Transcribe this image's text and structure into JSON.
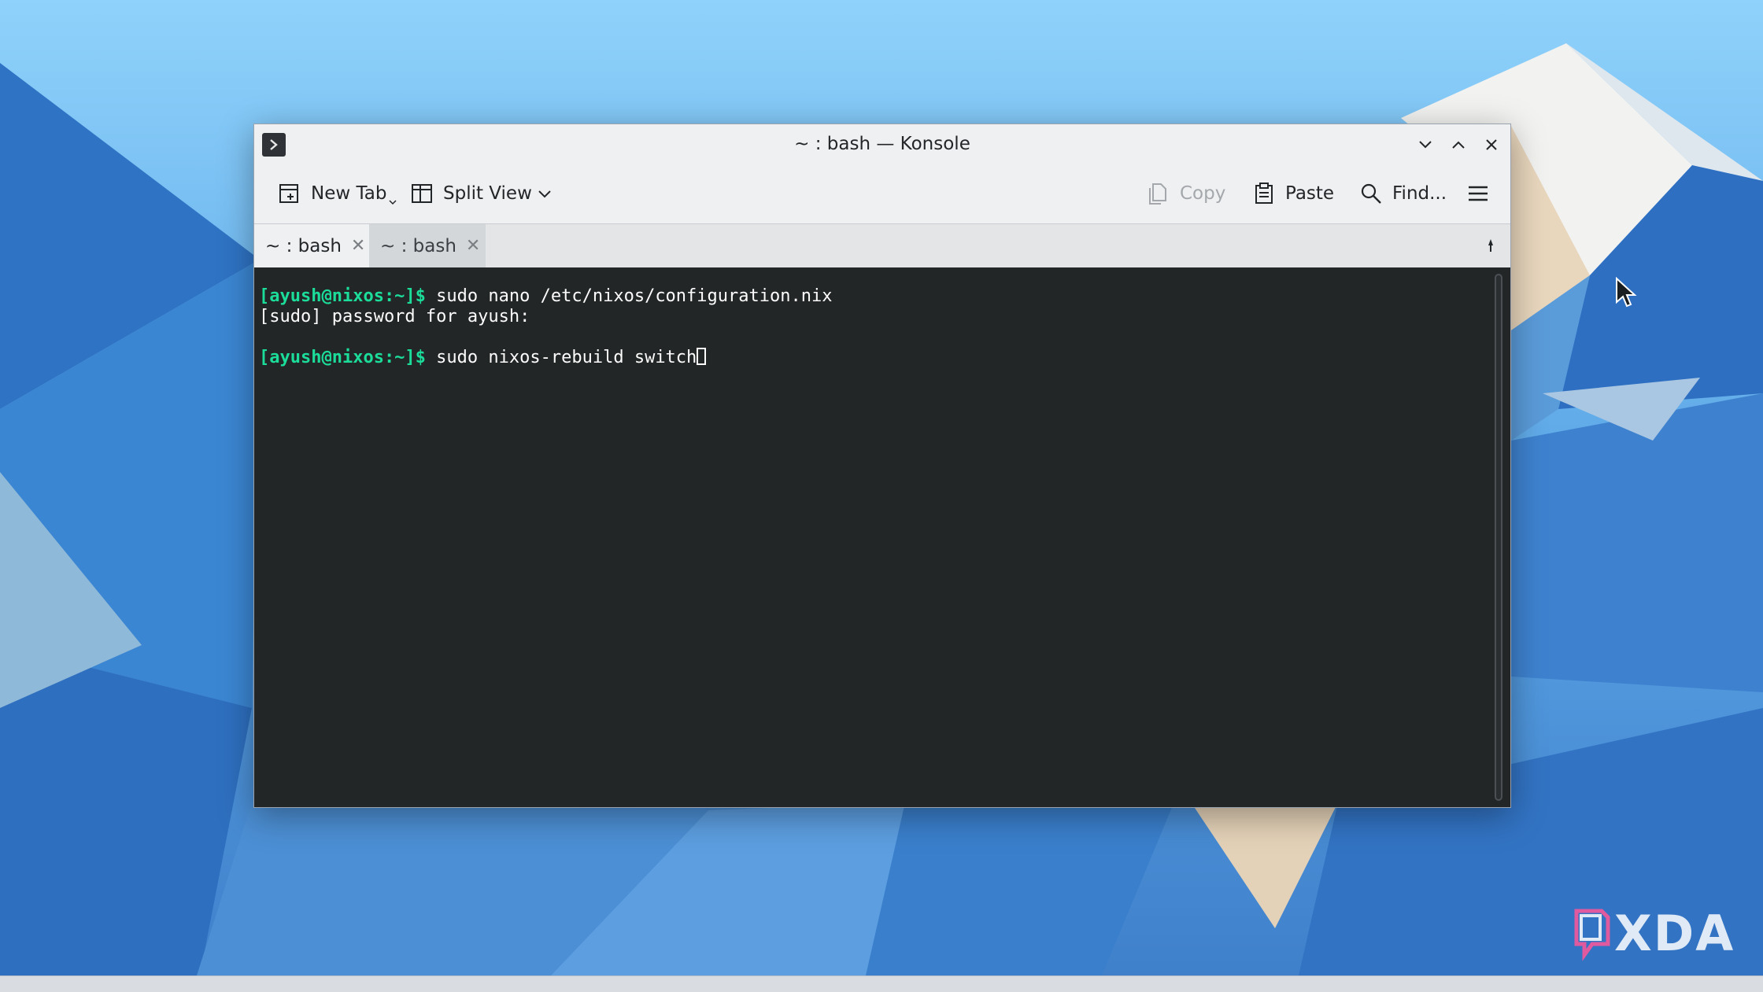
{
  "window": {
    "title": "~ : bash — Konsole",
    "icon": "konsole-icon"
  },
  "toolbar": {
    "new_tab_label": "New Tab",
    "split_view_label": "Split View",
    "copy_label": "Copy",
    "paste_label": "Paste",
    "find_label": "Find..."
  },
  "tabs": [
    {
      "label": "~ : bash",
      "active": true
    },
    {
      "label": "~ : bash",
      "active": false
    }
  ],
  "terminal": {
    "lines": [
      {
        "prompt": "[ayush@nixos:~]$",
        "text": " sudo nano /etc/nixos/configuration.nix"
      },
      {
        "prompt": "",
        "text": "[sudo] password for ayush:"
      },
      {
        "prompt": "",
        "text": ""
      },
      {
        "prompt": "[ayush@nixos:~]$",
        "text": " sudo nixos-rebuild switch"
      }
    ]
  },
  "watermark": {
    "text": "XDA"
  },
  "colors": {
    "prompt": "#1cdc9a",
    "terminal_bg": "#232627"
  }
}
